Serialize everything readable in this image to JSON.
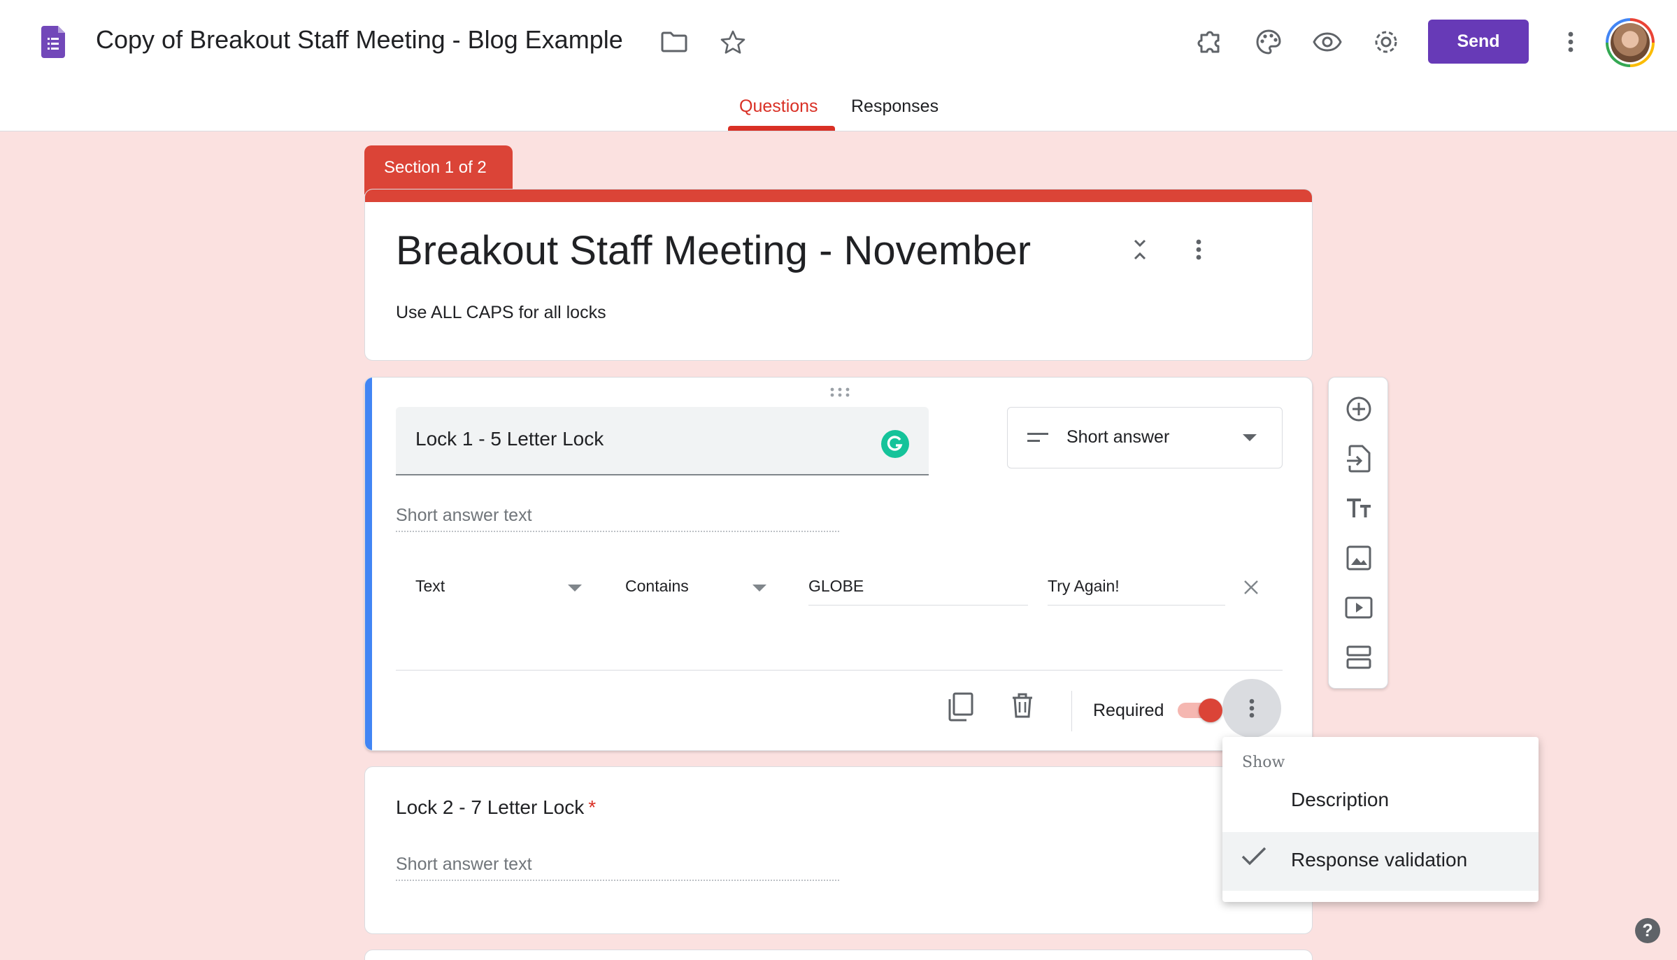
{
  "header": {
    "doc_title": "Copy of Breakout Staff Meeting - Blog Example",
    "send_label": "Send",
    "tabs": [
      {
        "label": "Questions",
        "active": true
      },
      {
        "label": "Responses",
        "active": false
      }
    ],
    "icons": [
      "forms-logo-icon",
      "folder-icon",
      "star-icon",
      "addon-puzzle-icon",
      "palette-icon",
      "preview-eye-icon",
      "settings-gear-icon",
      "more-vert-icon"
    ]
  },
  "section": {
    "label": "Section 1 of 2"
  },
  "form": {
    "title": "Breakout Staff Meeting - November",
    "description": "Use ALL CAPS for all locks"
  },
  "question1": {
    "title": "Lock 1 - 5 Letter Lock",
    "type": "Short answer",
    "placeholder": "Short answer text",
    "validation": {
      "category": "Text",
      "condition": "Contains",
      "value": "GLOBE",
      "error_text": "Try Again!"
    },
    "required_label": "Required",
    "required": true
  },
  "question2": {
    "title": "Lock 2 - 7 Letter Lock",
    "required_marker": "*",
    "placeholder": "Short answer text"
  },
  "side_toolbar": {
    "icons": [
      "add-question-icon",
      "import-questions-icon",
      "add-title-icon",
      "add-image-icon",
      "add-video-icon",
      "add-section-icon"
    ]
  },
  "menu": {
    "header": "Show",
    "items": [
      {
        "label": "Description",
        "checked": false
      },
      {
        "label": "Response validation",
        "checked": true
      }
    ]
  },
  "colors": {
    "accent": "#673ab7",
    "section_red": "#db4437",
    "active_tab": "#d93025",
    "question_highlight": "#4285f4",
    "background": "#fbe1e0"
  }
}
